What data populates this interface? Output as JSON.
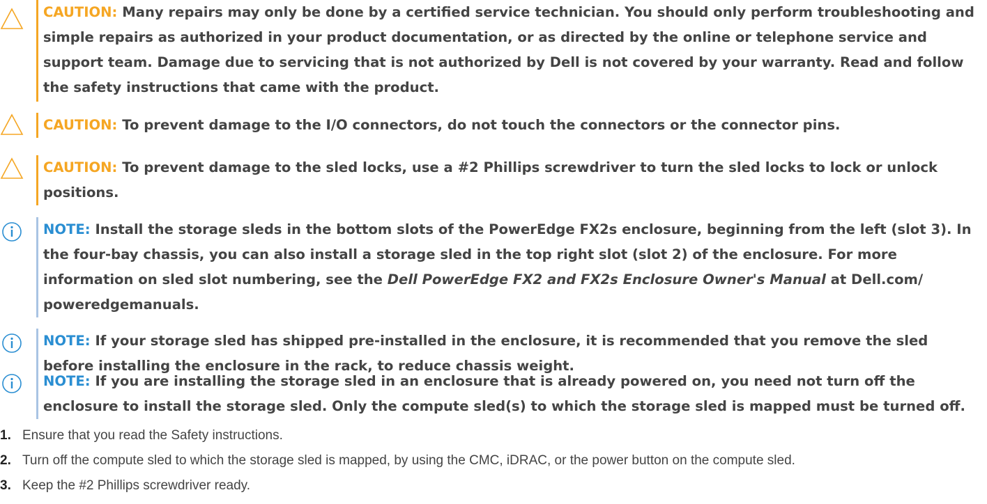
{
  "colors": {
    "caution_accent": "#f5a623",
    "note_accent": "#2a8ed2",
    "note_bar": "#a9c4e3",
    "body_text": "#444444"
  },
  "notices": [
    {
      "type": "caution",
      "icon": "warning-triangle-icon",
      "label": "CAUTION:",
      "text": "Many repairs may only be done by a certified service technician. You should only perform troubleshooting and simple repairs as authorized in your product documentation, or as directed by the online or telephone service and support team. Damage due to servicing that is not authorized by Dell is not covered by your warranty. Read and follow the safety instructions that came with the product."
    },
    {
      "type": "caution",
      "icon": "warning-triangle-icon",
      "label": "CAUTION:",
      "text": "To prevent damage to the I/O connectors, do not touch the connectors or the connector pins."
    },
    {
      "type": "caution",
      "icon": "warning-triangle-icon",
      "label": "CAUTION:",
      "text": "To prevent damage to the sled locks, use a #2 Phillips screwdriver to turn the sled locks to lock or unlock positions."
    },
    {
      "type": "note",
      "icon": "info-circle-icon",
      "label": "NOTE:",
      "text_before": "Install the storage sleds in the bottom slots of the PowerEdge FX2s enclosure, beginning from the left (slot 3). In the four-bay chassis, you can also install a storage sled in the top right slot (slot 2) of the enclosure. For more information on sled slot numbering, see the",
      "text_italic": "Dell PowerEdge FX2 and FX2s Enclosure Owner's Manual",
      "text_after": "at Dell.com/ poweredgemanuals."
    },
    {
      "type": "note",
      "icon": "info-circle-icon",
      "label": "NOTE:",
      "text": "If your storage sled has shipped pre-installed in the enclosure, it is recommended that you remove the sled before installing the enclosure in the rack, to reduce chassis weight."
    },
    {
      "type": "note",
      "icon": "info-circle-icon",
      "label": "NOTE:",
      "text": "If you are installing the storage sled in an enclosure that is already powered on, you need not turn off the enclosure to install the storage sled. Only the compute sled(s) to which the storage sled is mapped must be turned off."
    }
  ],
  "steps": [
    {
      "number": "1.",
      "text": "Ensure that you read the Safety instructions."
    },
    {
      "number": "2.",
      "text": "Turn off the compute sled to which the storage sled is mapped, by using the CMC, iDRAC, or the power button on the compute sled."
    },
    {
      "number": "3.",
      "text": "Keep the #2 Phillips screwdriver ready."
    }
  ]
}
